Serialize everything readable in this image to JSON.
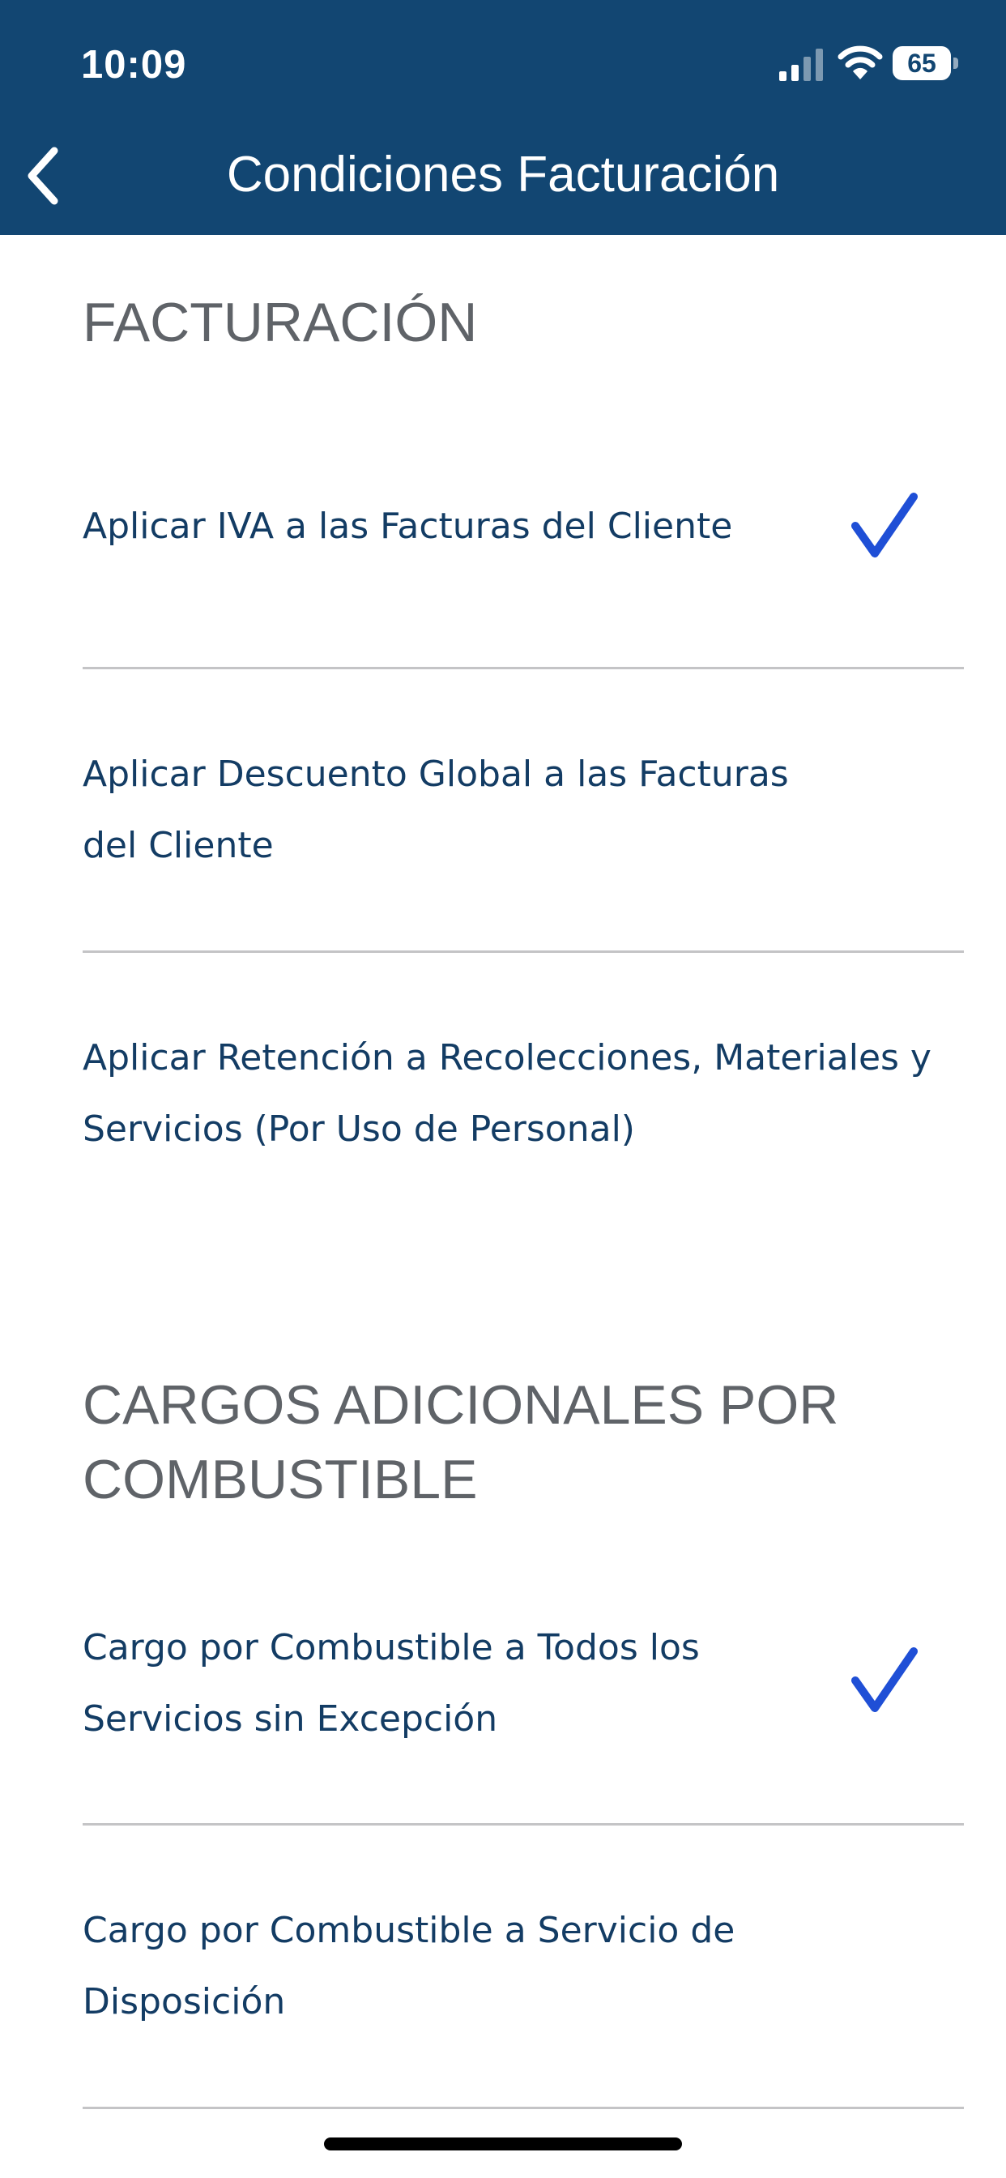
{
  "status_bar": {
    "time": "10:09",
    "battery_level": "65",
    "battery_fraction": 0.65,
    "signal_icon": "cellular-signal-icon",
    "wifi_icon": "wifi-icon"
  },
  "nav_bar": {
    "title": "Condiciones Facturación",
    "back_icon": "chevron-left-icon",
    "background_color": "#124672"
  },
  "sections": [
    {
      "title": "FACTURACIÓN",
      "items": [
        {
          "label": "Aplicar IVA a las Facturas del Cliente",
          "checked": true
        },
        {
          "label": "Aplicar Descuento Global a las Facturas del Cliente",
          "checked": false
        },
        {
          "label": "Aplicar Retención a Recolecciones, Materiales y Servicios (Por Uso de Personal)",
          "checked": false
        }
      ]
    },
    {
      "title": "CARGOS ADICIONALES POR COMBUSTIBLE",
      "items": [
        {
          "label": "Cargo por Combustible a Todos los Servicios sin Excepción",
          "checked": true
        },
        {
          "label": "Cargo por Combustible a Servicio de Disposición",
          "checked": false
        }
      ]
    }
  ],
  "colors": {
    "header": "#124672",
    "label_text": "#133c64",
    "section_title": "#5f6368",
    "checkmark": "#1f4fd6",
    "divider": "#c4c4c6"
  }
}
